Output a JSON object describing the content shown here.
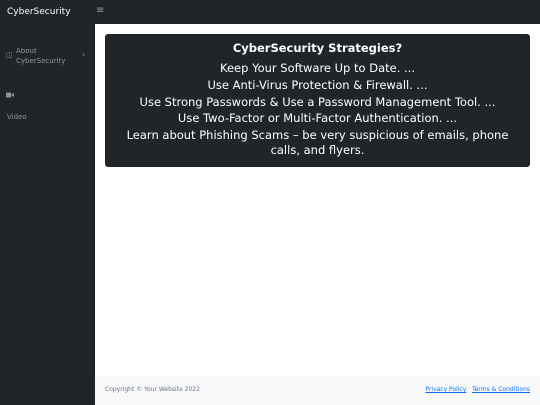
{
  "app": {
    "brand": "CyberSecurity"
  },
  "sidebar": {
    "items": [
      {
        "label": "About CyberSecurity",
        "icon": "columns-icon"
      },
      {
        "label": "Video",
        "icon": "video-icon"
      }
    ]
  },
  "main": {
    "card": {
      "title": "CyberSecurity Strategies?",
      "items": [
        "Keep Your Software Up to Date. ...",
        "Use Anti-Virus Protection & Firewall. ...",
        "Use Strong Passwords & Use a Password Management Tool. ...",
        "Use Two-Factor or Multi-Factor Authentication. ...",
        "Learn about Phishing Scams – be very suspicious of emails, phone calls, and flyers."
      ]
    }
  },
  "footer": {
    "copyright": "Copyright © Your Website 2022",
    "privacy_label": "Privacy Policy",
    "separator": "·",
    "terms_label": "Terms & Conditions"
  },
  "colors": {
    "dark": "#212529",
    "footer_bg": "#f8f9fa",
    "link": "#0d6efd"
  }
}
